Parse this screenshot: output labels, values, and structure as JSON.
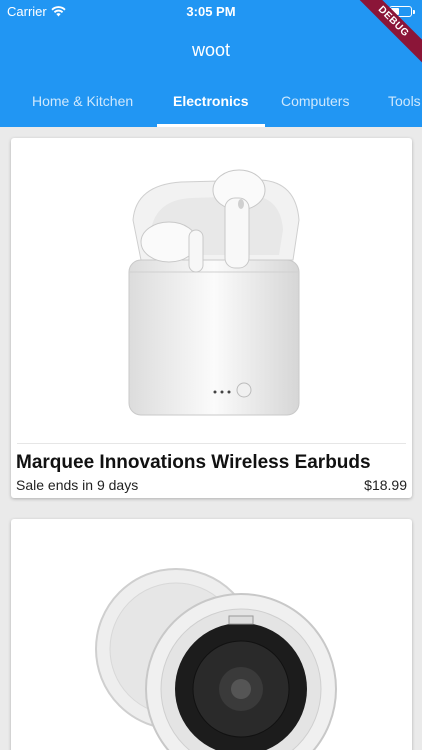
{
  "status": {
    "carrier": "Carrier",
    "time": "3:05 PM"
  },
  "debug_banner": "DEBUG",
  "appbar": {
    "title": "woot",
    "color": "#2196f3"
  },
  "tabs": [
    {
      "label": "Home & Kitchen",
      "active": false
    },
    {
      "label": "Electronics",
      "active": true
    },
    {
      "label": "Computers",
      "active": false
    },
    {
      "label": "Tools",
      "active": false
    }
  ],
  "products": [
    {
      "name": "Marquee Innovations Wireless Earbuds",
      "sale_text": "Sale ends in 9 days",
      "price": "$18.99",
      "image_icon": "earbuds-image"
    },
    {
      "image_icon": "ceiling-speaker-image"
    }
  ]
}
